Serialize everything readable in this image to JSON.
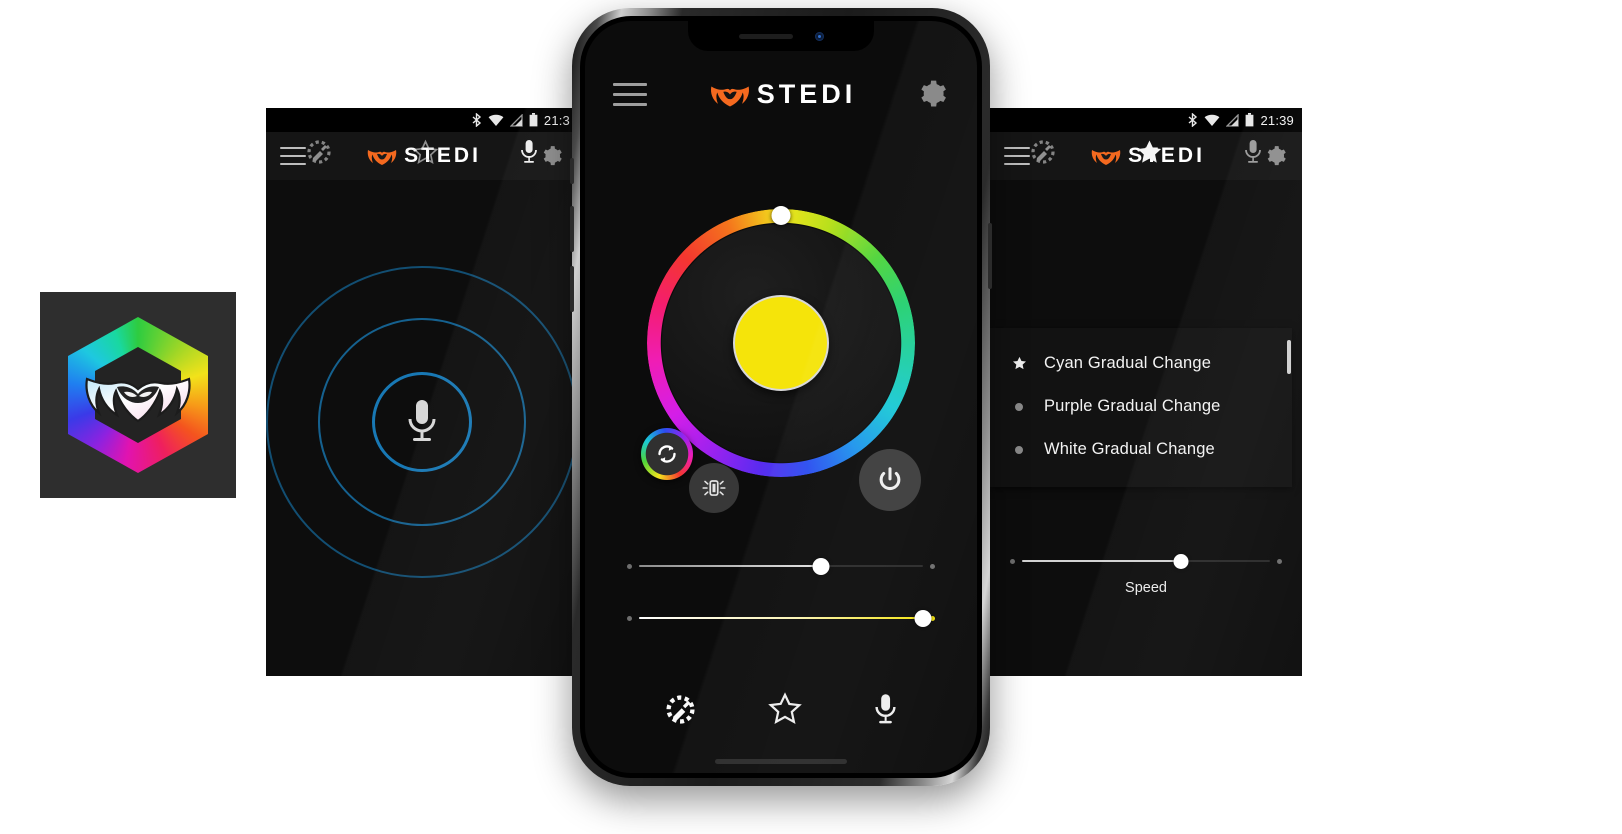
{
  "brand": {
    "name": "STEDI",
    "logo_color": "#f4691f",
    "wordmark_color": "#ffffff"
  },
  "app_icon": {
    "name": "app-icon",
    "tile_background": "#2e2e2e",
    "shape": "hexagon",
    "glyph": "owl-wings-logo",
    "palette": [
      "#2ecc40",
      "#f2e21a",
      "#f79a18",
      "#ef1f5e",
      "#8d22e0",
      "#1f7ff0",
      "#1ec8e0"
    ]
  },
  "left_phone": {
    "platform": "android",
    "statusbar": {
      "time": "21:3",
      "icons": [
        "bluetooth-icon",
        "wifi-icon",
        "signal-icon",
        "battery-icon"
      ]
    },
    "appbar": {
      "menu_icon": "hamburger-menu-icon",
      "title": "STEDI",
      "settings_icon": "gear-icon"
    },
    "screen": {
      "name": "voice-control-screen",
      "center_icon": "microphone-icon",
      "ring_color": "#1878b4",
      "ring_count": 3
    },
    "navbar": {
      "items": [
        {
          "name": "tab-color-picker",
          "icon": "color-picker-icon",
          "active": false
        },
        {
          "name": "tab-favourites",
          "icon": "star-outline-icon",
          "active": false
        },
        {
          "name": "tab-voice",
          "icon": "microphone-icon",
          "active": true
        }
      ]
    }
  },
  "center_phone": {
    "platform": "ios",
    "notch": {
      "speaker": "speaker-grille",
      "camera": "front-camera"
    },
    "appbar": {
      "menu_icon": "hamburger-menu-icon",
      "title": "STEDI",
      "settings_icon": "gear-icon"
    },
    "screen": {
      "name": "color-picker-screen",
      "color_wheel": {
        "selected_color": "#f5e40a",
        "handle_position_deg": 0,
        "handle_label": "color-wheel-handle"
      },
      "buttons": [
        {
          "name": "color-cycle-button",
          "icon": "refresh-cycle-icon"
        },
        {
          "name": "strobe-button",
          "icon": "strobe-flash-icon"
        },
        {
          "name": "power-button",
          "icon": "power-icon"
        }
      ],
      "sliders": [
        {
          "name": "speed-slider",
          "value_pct": 63,
          "fill_color": "#d9d9d9",
          "track_color": "#2a2a2a"
        },
        {
          "name": "brightness-slider",
          "value_pct": 96,
          "fill_from": "#ffffff",
          "fill_to": "#f5e40a"
        }
      ]
    },
    "navbar": {
      "items": [
        {
          "name": "tab-color-picker",
          "icon": "color-picker-icon",
          "active": true
        },
        {
          "name": "tab-favourites",
          "icon": "star-outline-icon",
          "active": false
        },
        {
          "name": "tab-voice",
          "icon": "microphone-icon",
          "active": false
        }
      ]
    }
  },
  "right_phone": {
    "platform": "android",
    "statusbar": {
      "time": "21:39",
      "icons": [
        "bluetooth-icon",
        "wifi-icon",
        "signal-icon",
        "battery-icon"
      ]
    },
    "appbar": {
      "menu_icon": "hamburger-menu-icon",
      "title": "STEDI",
      "settings_icon": "gear-icon"
    },
    "screen": {
      "name": "favourites-screen",
      "presets": [
        {
          "label": "Cyan Gradual Change",
          "selected": true,
          "marker": "star-filled-icon"
        },
        {
          "label": "Purple Gradual Change",
          "selected": false,
          "marker": "dot-icon"
        },
        {
          "label": "White Gradual Change",
          "selected": false,
          "marker": "dot-icon"
        }
      ],
      "speed_slider": {
        "name": "speed-slider",
        "label": "Speed",
        "value_pct": 63
      }
    },
    "navbar": {
      "items": [
        {
          "name": "tab-color-picker",
          "icon": "color-picker-icon",
          "active": false
        },
        {
          "name": "tab-favourites",
          "icon": "star-filled-icon",
          "active": true
        },
        {
          "name": "tab-voice",
          "icon": "microphone-icon",
          "active": false
        }
      ]
    }
  }
}
